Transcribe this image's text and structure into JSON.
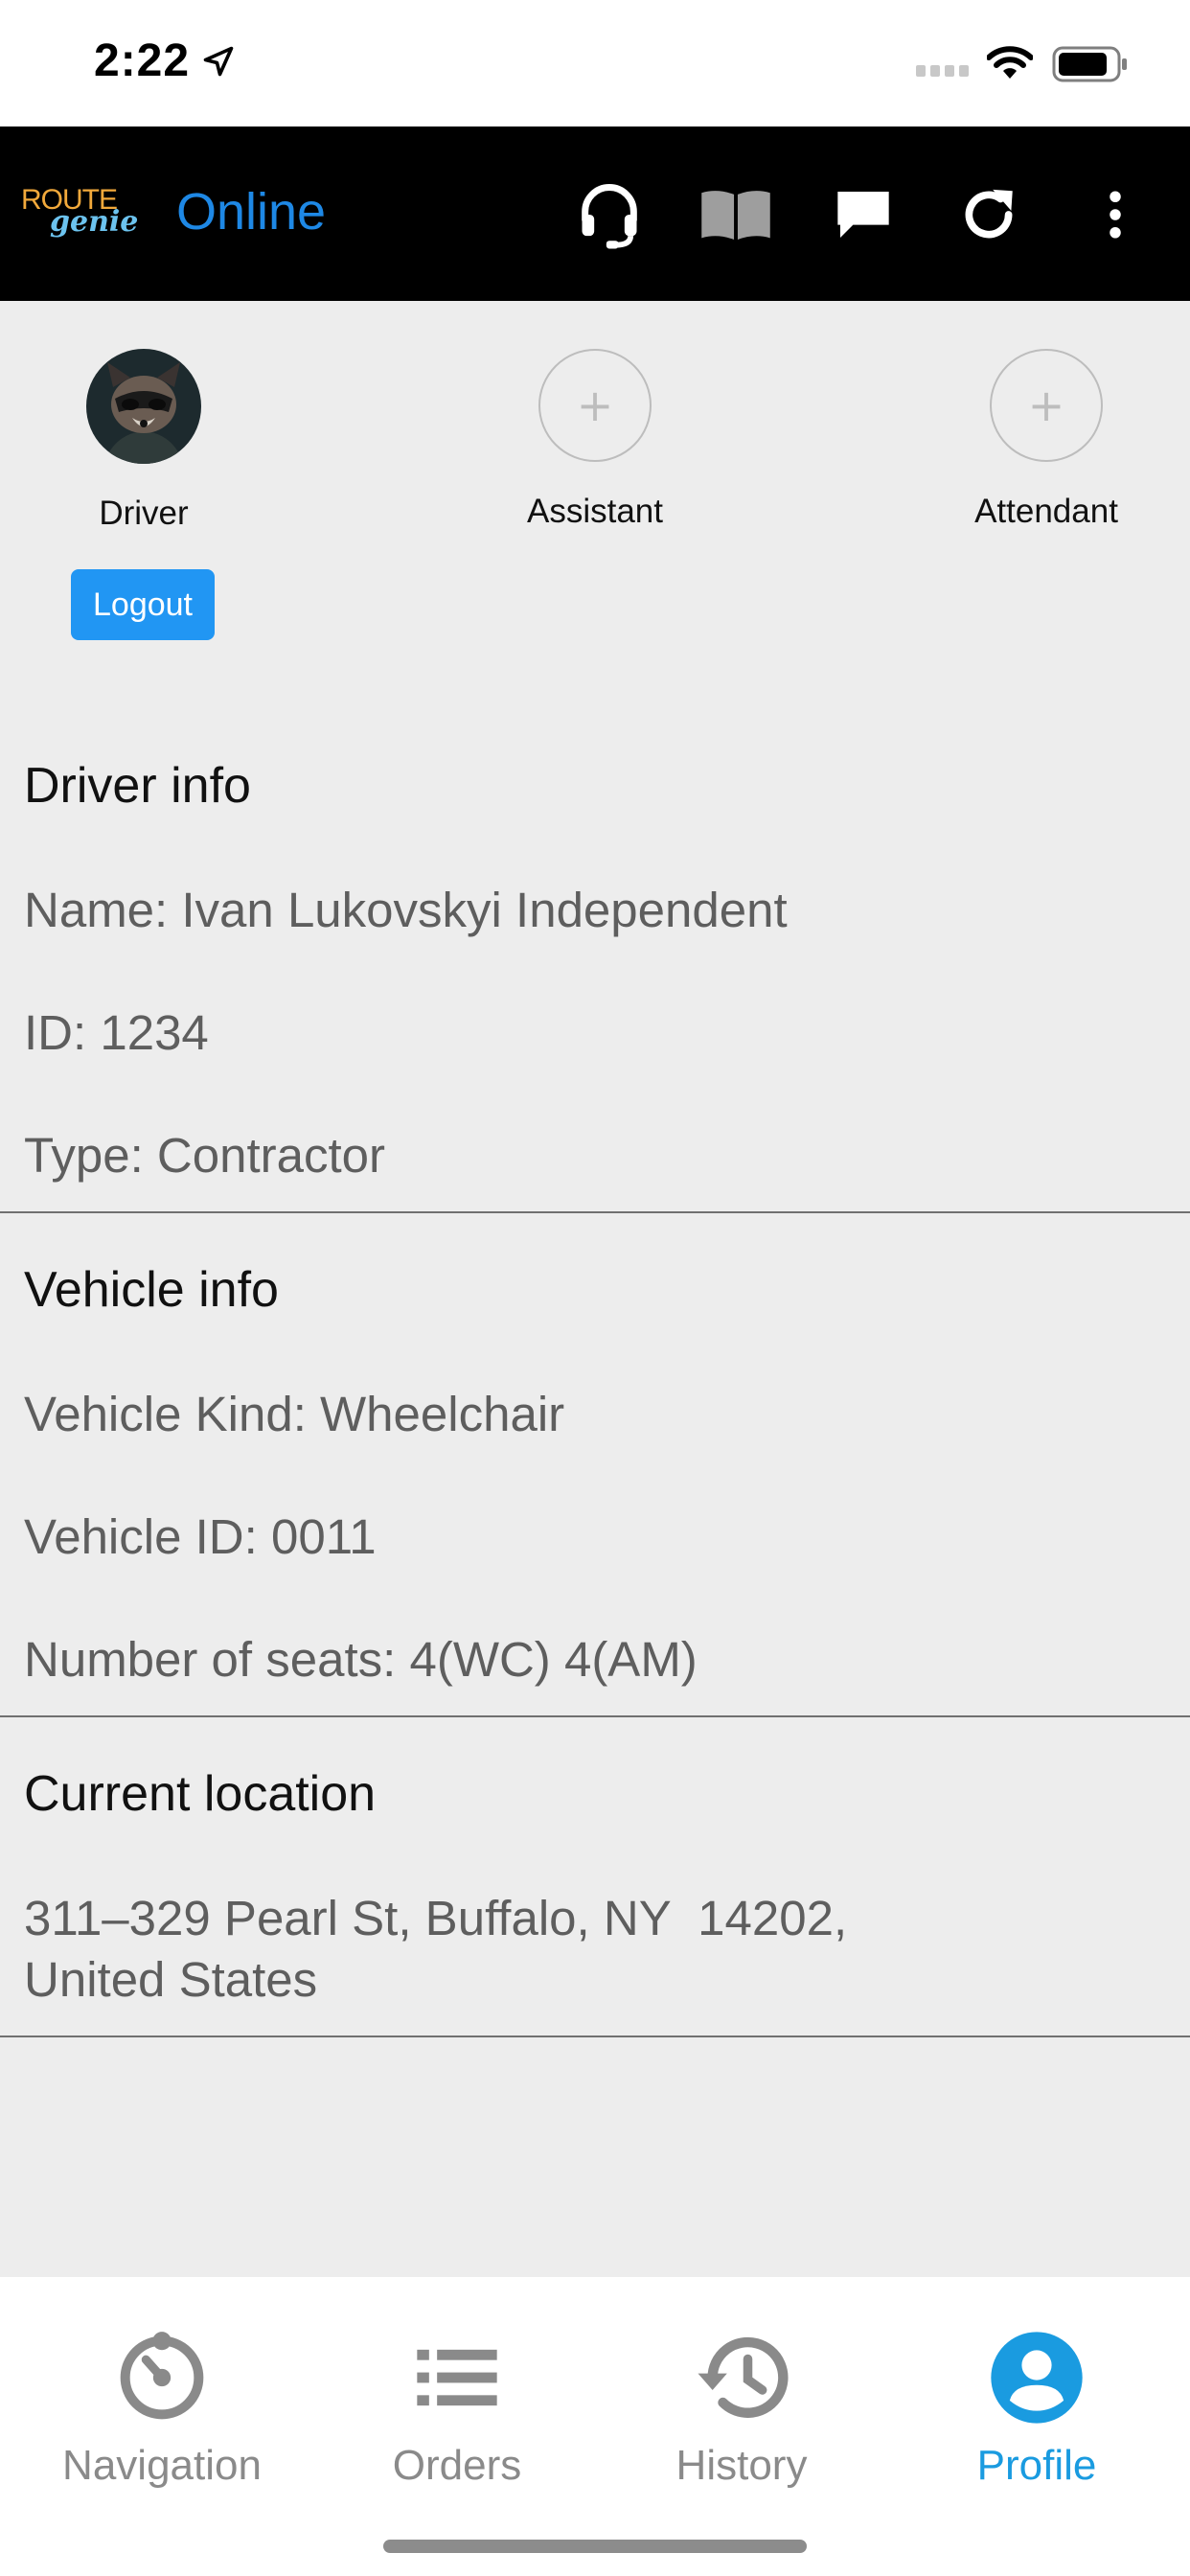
{
  "status_bar": {
    "time": "2:22"
  },
  "header": {
    "logo_top": "ROUTE",
    "logo_bottom": "genie",
    "status": "Online",
    "icons": [
      "headset-icon",
      "book-icon",
      "chat-icon",
      "refresh-icon",
      "more-vert-icon"
    ]
  },
  "crew": {
    "driver_label": "Driver",
    "assistant_label": "Assistant",
    "attendant_label": "Attendant",
    "add_symbol": "+",
    "logout_label": "Logout"
  },
  "driver_info": {
    "title": "Driver info",
    "name": "Name: Ivan Lukovskyi Independent",
    "id": "ID: 1234",
    "type": "Type: Contractor"
  },
  "vehicle_info": {
    "title": "Vehicle info",
    "kind": "Vehicle Kind: Wheelchair",
    "vehicle_id": "Vehicle ID: 0011",
    "seats": "Number of seats: 4(WC) 4(AM)"
  },
  "location": {
    "title": "Current location",
    "line1": "311–329 Pearl St, Buffalo, NY  14202,",
    "line2": "United States"
  },
  "bottom_nav": {
    "tabs": [
      {
        "label": "Navigation",
        "icon": "navigation-icon"
      },
      {
        "label": "Orders",
        "icon": "list-icon"
      },
      {
        "label": "History",
        "icon": "history-icon"
      },
      {
        "label": "Profile",
        "icon": "profile-icon",
        "active": true
      }
    ]
  },
  "colors": {
    "accent": "#1e88e5",
    "header_bg": "#000000",
    "logout_bg": "#2196f3",
    "active_tab": "#1a9be0"
  }
}
